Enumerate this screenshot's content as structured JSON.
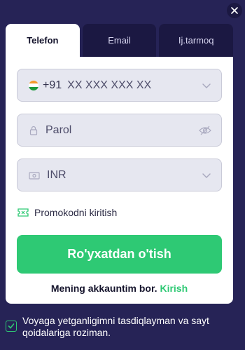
{
  "tabs": [
    {
      "label": "Telefon",
      "active": true
    },
    {
      "label": "Email",
      "active": false
    },
    {
      "label": "Ij.tarmoq",
      "active": false
    }
  ],
  "phone": {
    "country_code": "+91",
    "placeholder": "XX XXX XXX XX",
    "flag_icon": "india-flag-icon"
  },
  "password": {
    "placeholder": "Parol"
  },
  "currency": {
    "value": "INR"
  },
  "promo": {
    "label": "Promokodni kiritish"
  },
  "submit": {
    "label": "Ro'yxatdan o'tish"
  },
  "login": {
    "prompt": "Mening akkauntim bor.",
    "link": "Kirish"
  },
  "agreement": {
    "checked": true,
    "text": "Voyaga yetganligimni tasdiqlayman va sayt qoidalariga roziman."
  },
  "colors": {
    "background": "#262356",
    "accent": "#2ec974",
    "field_bg": "#e6e7f0"
  }
}
